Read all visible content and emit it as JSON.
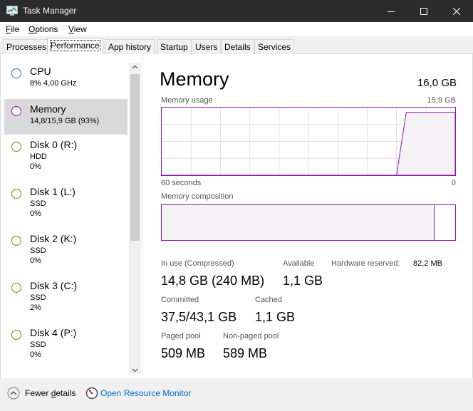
{
  "window": {
    "title": "Task Manager",
    "icon": "task-manager-icon"
  },
  "menu": [
    {
      "label": "File",
      "key": "F",
      "rest": "ile"
    },
    {
      "label": "Options",
      "key": "O",
      "rest": "ptions"
    },
    {
      "label": "View",
      "key": "V",
      "rest": "iew"
    }
  ],
  "tabs": [
    "Processes",
    "Performance",
    "App history",
    "Startup",
    "Users",
    "Details",
    "Services"
  ],
  "active_tab": "Performance",
  "sidebar": {
    "items": [
      {
        "name": "CPU",
        "line1": "8%  4,00 GHz",
        "line2": "",
        "color": "#1a7abf"
      },
      {
        "name": "Memory",
        "line1": "14,8/15,9 GB (93%)",
        "line2": "",
        "color": "#8b12ae"
      },
      {
        "name": "Disk 0 (R:)",
        "line1": "HDD",
        "line2": "0%",
        "color": "#4e9a06"
      },
      {
        "name": "Disk 1 (L:)",
        "line1": "SSD",
        "line2": "0%",
        "color": "#4e9a06"
      },
      {
        "name": "Disk 2 (K:)",
        "line1": "SSD",
        "line2": "0%",
        "color": "#4e9a06"
      },
      {
        "name": "Disk 3 (C:)",
        "line1": "SSD",
        "line2": "2%",
        "color": "#4e9a06"
      },
      {
        "name": "Disk 4 (P:)",
        "line1": "SSD",
        "line2": "0%",
        "color": "#4e9a06"
      }
    ],
    "selected": "Memory"
  },
  "memory": {
    "title": "Memory",
    "total": "16,0 GB",
    "usage_label": "Memory usage",
    "usage_max": "15,9 GB",
    "time_left": "60 seconds",
    "time_right": "0",
    "composition_label": "Memory composition",
    "composition": {
      "in_use_fraction": 0.93,
      "standby_fraction": 0.01
    },
    "usage_history": {
      "x_seconds": [
        60,
        12,
        10,
        0
      ],
      "fraction": [
        0,
        0,
        0.93,
        0.93
      ]
    },
    "stats": {
      "in_use_label": "In use (Compressed)",
      "in_use_value": "14,8 GB (240 MB)",
      "available_label": "Available",
      "available_value": "1,1 GB",
      "hw_reserved_label": "Hardware reserved:",
      "hw_reserved_value": "82,2 MB",
      "committed_label": "Committed",
      "committed_value": "37,5/43,1 GB",
      "cached_label": "Cached",
      "cached_value": "1,1 GB",
      "paged_label": "Paged pool",
      "paged_value": "509 MB",
      "nonpaged_label": "Non-paged pool",
      "nonpaged_value": "589 MB"
    }
  },
  "footer": {
    "fewer_details": "Fewer details",
    "fewer_key": "d",
    "fewer_prefix": "Fewer ",
    "fewer_rest": "etails",
    "resource_monitor": "Open Resource Monitor"
  },
  "colors": {
    "accent": "#8b12ae",
    "link": "#0066cc",
    "titlebar": "#2b2b2b"
  }
}
